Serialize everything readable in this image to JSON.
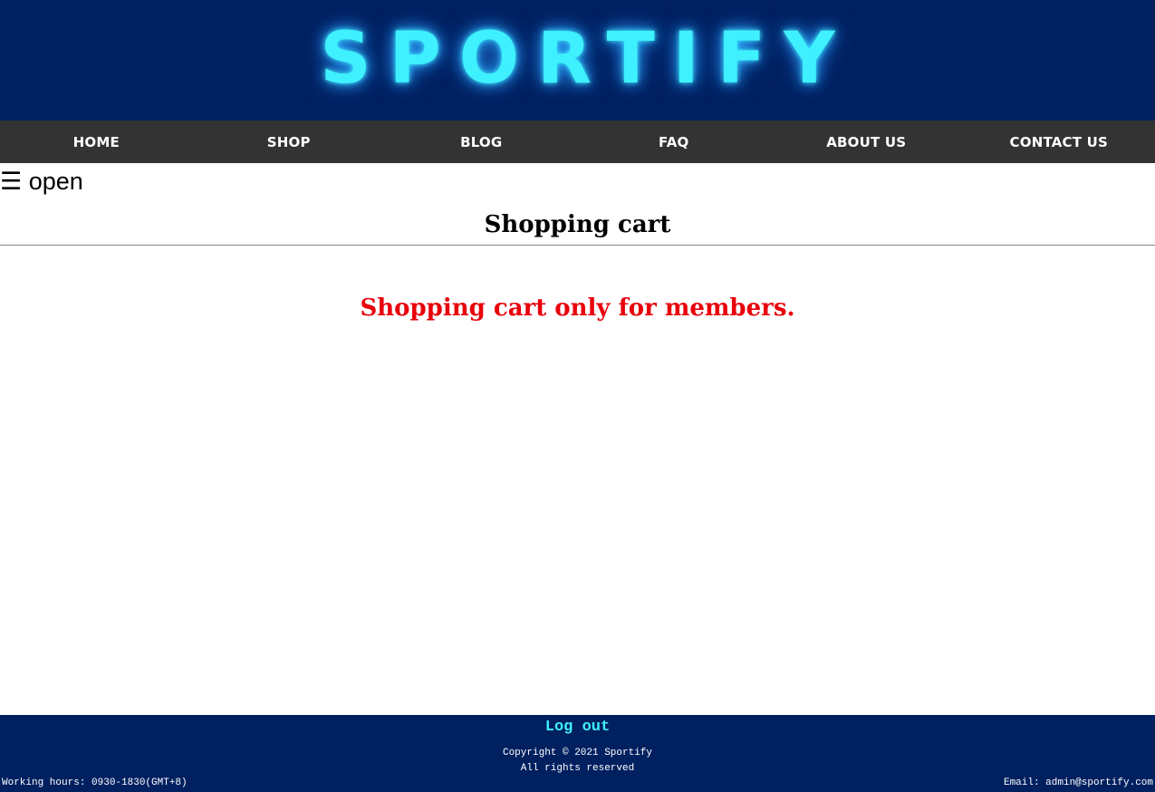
{
  "header": {
    "logo_text": "SPORTIFY",
    "background_color": "#012060",
    "logo_color": "#3ff0ff"
  },
  "nav": {
    "items": [
      {
        "label": "HOME"
      },
      {
        "label": "SHOP"
      },
      {
        "label": "BLOG"
      },
      {
        "label": "FAQ"
      },
      {
        "label": "ABOUT US"
      },
      {
        "label": "CONTACT US"
      }
    ],
    "background_color": "#333333"
  },
  "sidebar_toggle": {
    "label": "☰ open",
    "icon": "hamburger-icon"
  },
  "main": {
    "title": "Shopping cart",
    "notice": "Shopping cart only for members.",
    "notice_color": "#e8000b"
  },
  "footer": {
    "logout_label": "Log out",
    "copyright_line1": "Copyright © 2021 Sportify",
    "copyright_line2": "All rights reserved",
    "working_hours": "Working hours: 0930-1830(GMT+8)",
    "email": "Email: admin@sportify.com"
  }
}
